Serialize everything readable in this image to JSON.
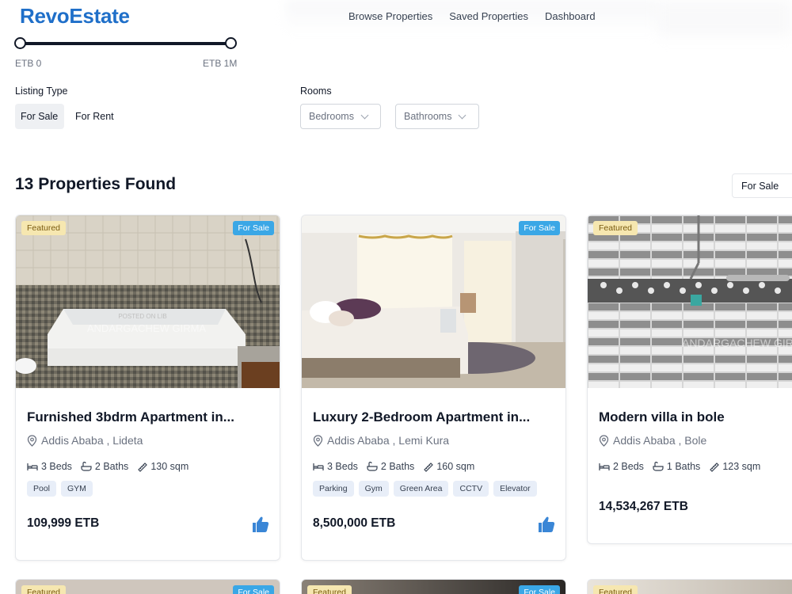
{
  "app": {
    "name": "RevoEstate"
  },
  "nav": {
    "items": [
      "Browse Properties",
      "Saved Properties",
      "Dashboard"
    ]
  },
  "price_filter": {
    "min_label": "ETB 0",
    "max_label": "ETB 1M",
    "range_fraction": [
      0,
      1
    ]
  },
  "filters": {
    "listing_type_label": "Listing Type",
    "listing_types": [
      "For Sale",
      "For Rent"
    ],
    "selected_listing_type": "For Sale",
    "rooms_label": "Rooms",
    "bedrooms_placeholder": "Bedrooms",
    "bathrooms_placeholder": "Bathrooms"
  },
  "results": {
    "title": "13 Properties Found",
    "sort_value": "For Sale"
  },
  "cards": [
    {
      "featured": "Featured",
      "status": "For Sale",
      "title": "Furnished 3bdrm Apartment in...",
      "location": "Addis Ababa , Lideta",
      "beds": "3 Beds",
      "baths": "2 Baths",
      "area": "130 sqm",
      "tags": [
        "Pool",
        "GYM"
      ],
      "price": "109,999 ETB",
      "watermark": "ANDARGACHEW GIRMA"
    },
    {
      "featured": "",
      "status": "For Sale",
      "title": "Luxury 2-Bedroom Apartment in...",
      "location": "Addis Ababa , Lemi Kura",
      "beds": "3 Beds",
      "baths": "2 Baths",
      "area": "160 sqm",
      "tags": [
        "Parking",
        "Gym",
        "Green Area",
        "CCTV",
        "Elevator"
      ],
      "price": "8,500,000 ETB"
    },
    {
      "featured": "Featured",
      "status": "",
      "title": "Modern villa in bole",
      "location": "Addis Ababa , Bole",
      "beds": "2 Beds",
      "baths": "1 Baths",
      "area": "123 sqm",
      "tags": [],
      "price": "14,534,267 ETB",
      "watermark": "ANDARGACHEW GIRMA"
    }
  ],
  "peek_cards": [
    {
      "featured": "Featured",
      "status": "For Sale"
    },
    {
      "featured": "Featured",
      "status": "For Sale"
    },
    {
      "featured": "Featured",
      "status": ""
    }
  ],
  "colors": {
    "brand": "#1f6fc9",
    "featured_bg": "#f6e7b0",
    "sale_badge": "#3aa7e6",
    "like": "#3a86d6"
  },
  "icons": [
    "location-pin-icon",
    "bed-icon",
    "bath-icon",
    "area-icon",
    "thumbs-up-icon",
    "chevron-down-icon"
  ]
}
